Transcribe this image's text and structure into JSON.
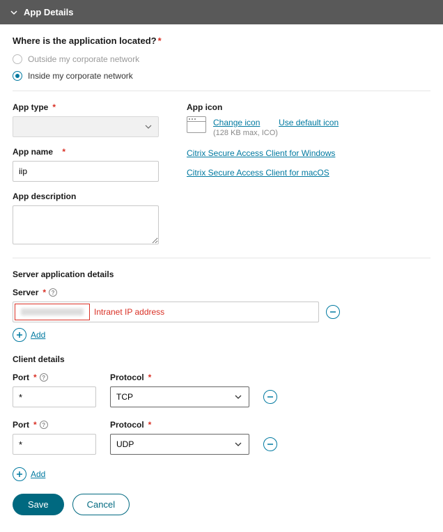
{
  "header": {
    "title": "App Details"
  },
  "location": {
    "question": "Where is the application located?",
    "options": {
      "outside": "Outside my corporate network",
      "inside": "Inside my corporate network"
    },
    "selected": "inside"
  },
  "appType": {
    "label": "App type",
    "value": ""
  },
  "appName": {
    "label": "App name",
    "value": "iip"
  },
  "appDesc": {
    "label": "App description",
    "value": ""
  },
  "appIcon": {
    "label": "App icon",
    "changeLink": "Change icon",
    "defaultLink": "Use default icon",
    "hint": "(128 KB max, ICO)"
  },
  "downloads": {
    "win": "Citrix Secure Access Client for Windows",
    "mac": "Citrix Secure Access Client for macOS"
  },
  "serverSection": {
    "title": "Server application details",
    "serverLabel": "Server",
    "annotation": "Intranet IP address",
    "addLabel": "Add"
  },
  "clientSection": {
    "title": "Client details",
    "portLabel": "Port",
    "protocolLabel": "Protocol",
    "rows": [
      {
        "port": "*",
        "protocol": "TCP"
      },
      {
        "port": "*",
        "protocol": "UDP"
      }
    ],
    "addLabel": "Add"
  },
  "buttons": {
    "save": "Save",
    "cancel": "Cancel"
  }
}
